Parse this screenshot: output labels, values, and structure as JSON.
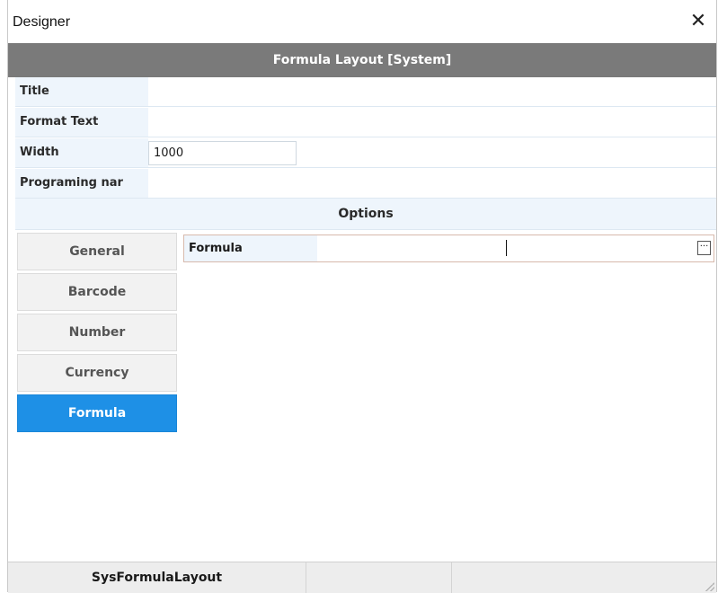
{
  "window": {
    "title": "Designer",
    "close_glyph": "✕"
  },
  "header": {
    "title": "Formula Layout [System]"
  },
  "properties": [
    {
      "label": "Title",
      "value": ""
    },
    {
      "label": "Format Text",
      "value": ""
    },
    {
      "label": "Width",
      "value": "1000"
    },
    {
      "label": "Programing nar",
      "value": ""
    }
  ],
  "options": {
    "label": "Options"
  },
  "tabs": [
    {
      "label": "General",
      "active": false
    },
    {
      "label": "Barcode",
      "active": false
    },
    {
      "label": "Number",
      "active": false
    },
    {
      "label": "Currency",
      "active": false
    },
    {
      "label": "Formula",
      "active": true
    }
  ],
  "formula": {
    "label": "Formula",
    "value": "",
    "button_glyph": "···"
  },
  "statusbar": {
    "cells": [
      "SysFormulaLayout",
      "",
      ""
    ]
  },
  "colors": {
    "header_bg": "#7a7a7a",
    "active_tab": "#1e90e6",
    "label_bg": "#eef5fc"
  },
  "icons": {
    "close": "close-icon",
    "ellipsis": "ellipsis-icon",
    "grip": "resize-grip-icon"
  }
}
